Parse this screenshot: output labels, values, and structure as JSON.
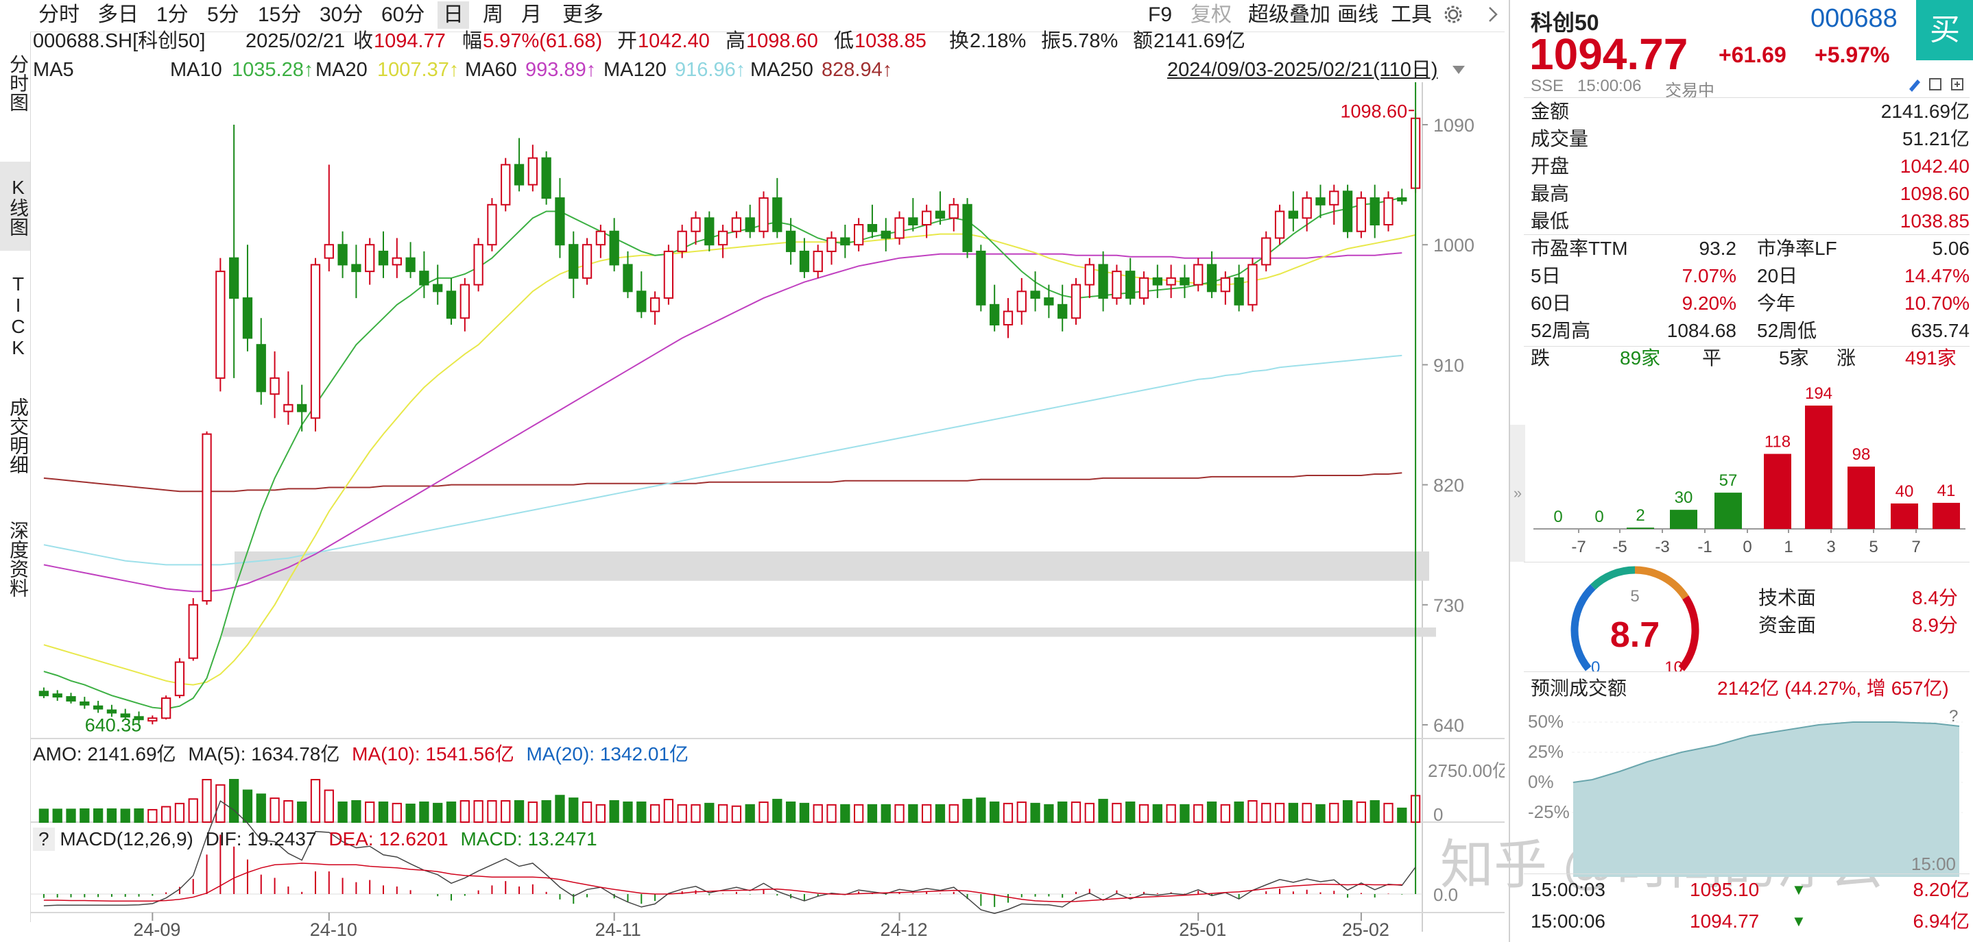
{
  "toolbar": {
    "periods": [
      "分时",
      "多日",
      "1分",
      "5分",
      "15分",
      "30分",
      "60分",
      "日",
      "周",
      "月",
      "更多"
    ],
    "active_period": "日",
    "right": [
      "F9",
      "复权",
      "超级叠加",
      "画线",
      "工具"
    ]
  },
  "side_tabs": [
    "分时图",
    "K线图",
    "TICK",
    "成交明细",
    "深度资料"
  ],
  "active_side_tab": "K线图",
  "info": {
    "code": "000688.SH[科创50]",
    "date": "2025/02/21",
    "close_label": "收",
    "close": "1094.77",
    "chg_label": "幅",
    "chg": "5.97%(61.68)",
    "open_label": "开",
    "open": "1042.40",
    "high_label": "高",
    "high": "1098.60",
    "low_label": "低",
    "low": "1038.85",
    "turnover_label": "换",
    "turnover": "2.18%",
    "amplitude_label": "振",
    "amplitude": "5.78%",
    "amount_label": "额",
    "amount": "2141.69亿"
  },
  "ma": {
    "ma5": "MA5",
    "ma10_label": "MA10",
    "ma10": "1035.28↑",
    "ma20_label": "MA20",
    "ma20": "1007.37↑",
    "ma60_label": "MA60",
    "ma60": "993.89↑",
    "ma120_label": "MA120",
    "ma120": "916.96↑",
    "ma250_label": "MA250",
    "ma250": "828.94↑",
    "range": "2024/09/03-2025/02/21(110日)"
  },
  "colors": {
    "up": "#d0021b",
    "down": "#1a8a1a",
    "ma10": "#3cb043",
    "ma20": "#e8e84a",
    "ma60": "#c040c0",
    "ma120": "#9ee0ea",
    "ma250": "#a03030"
  },
  "chart_data": {
    "type": "candlestick",
    "y_ticks": [
      "1090",
      "1000",
      "910",
      "820",
      "730",
      "640"
    ],
    "ylim": [
      640,
      1090
    ],
    "x_ticks": [
      "24-09",
      "24-10",
      "24-11",
      "24-12",
      "25-01",
      "25-02"
    ],
    "high_label": "1098.60",
    "low_label": "640.35",
    "candles_ohlc": [
      [
        665,
        668,
        660,
        662
      ],
      [
        663,
        666,
        658,
        661
      ],
      [
        661,
        664,
        656,
        658
      ],
      [
        657,
        661,
        652,
        655
      ],
      [
        654,
        658,
        649,
        652
      ],
      [
        651,
        655,
        646,
        649
      ],
      [
        648,
        652,
        644,
        646
      ],
      [
        646,
        650,
        641,
        644
      ],
      [
        643,
        647,
        640.35,
        645
      ],
      [
        645,
        662,
        644,
        660
      ],
      [
        662,
        690,
        660,
        687
      ],
      [
        690,
        735,
        688,
        730
      ],
      [
        733,
        860,
        730,
        858
      ],
      [
        900,
        990,
        890,
        980
      ],
      [
        990,
        1090,
        900,
        960
      ],
      [
        960,
        1000,
        920,
        930
      ],
      [
        925,
        945,
        880,
        890
      ],
      [
        888,
        920,
        870,
        900
      ],
      [
        875,
        905,
        865,
        880
      ],
      [
        880,
        895,
        860,
        875
      ],
      [
        870,
        990,
        860,
        985
      ],
      [
        990,
        1060,
        980,
        1000
      ],
      [
        1000,
        1010,
        975,
        985
      ],
      [
        985,
        1000,
        960,
        980
      ],
      [
        980,
        1005,
        970,
        1000
      ],
      [
        995,
        1010,
        975,
        985
      ],
      [
        985,
        1005,
        975,
        990
      ],
      [
        990,
        1002,
        975,
        980
      ],
      [
        980,
        995,
        960,
        970
      ],
      [
        970,
        985,
        955,
        965
      ],
      [
        965,
        975,
        940,
        945
      ],
      [
        945,
        975,
        935,
        970
      ],
      [
        970,
        1005,
        965,
        1000
      ],
      [
        1000,
        1035,
        995,
        1030
      ],
      [
        1030,
        1065,
        1025,
        1060
      ],
      [
        1060,
        1080,
        1040,
        1045
      ],
      [
        1045,
        1075,
        1040,
        1065
      ],
      [
        1065,
        1070,
        1030,
        1035
      ],
      [
        1035,
        1050,
        990,
        1000
      ],
      [
        1000,
        1010,
        960,
        975
      ],
      [
        975,
        1005,
        970,
        1000
      ],
      [
        1000,
        1015,
        990,
        1010
      ],
      [
        1010,
        1020,
        980,
        985
      ],
      [
        985,
        995,
        960,
        965
      ],
      [
        965,
        980,
        945,
        950
      ],
      [
        950,
        965,
        940,
        960
      ],
      [
        960,
        1000,
        955,
        995
      ],
      [
        995,
        1015,
        990,
        1010
      ],
      [
        1010,
        1025,
        1000,
        1020
      ],
      [
        1020,
        1025,
        995,
        1000
      ],
      [
        1000,
        1015,
        990,
        1010
      ],
      [
        1010,
        1025,
        1005,
        1020
      ],
      [
        1020,
        1030,
        1005,
        1010
      ],
      [
        1010,
        1040,
        1005,
        1035
      ],
      [
        1035,
        1050,
        1005,
        1010
      ],
      [
        1010,
        1020,
        985,
        995
      ],
      [
        995,
        1005,
        975,
        980
      ],
      [
        980,
        1000,
        975,
        995
      ],
      [
        995,
        1010,
        985,
        1005
      ],
      [
        1005,
        1015,
        990,
        1000
      ],
      [
        1000,
        1020,
        995,
        1015
      ],
      [
        1015,
        1030,
        1005,
        1010
      ],
      [
        1010,
        1020,
        995,
        1005
      ],
      [
        1005,
        1025,
        1000,
        1020
      ],
      [
        1020,
        1035,
        1010,
        1015
      ],
      [
        1015,
        1030,
        1005,
        1025
      ],
      [
        1025,
        1040,
        1015,
        1020
      ],
      [
        1020,
        1035,
        1010,
        1030
      ],
      [
        1030,
        1035,
        990,
        995
      ],
      [
        995,
        1000,
        950,
        955
      ],
      [
        955,
        970,
        935,
        940
      ],
      [
        940,
        960,
        930,
        950
      ],
      [
        950,
        975,
        940,
        965
      ],
      [
        965,
        980,
        950,
        960
      ],
      [
        960,
        970,
        945,
        955
      ],
      [
        955,
        970,
        935,
        945
      ],
      [
        945,
        975,
        940,
        970
      ],
      [
        970,
        990,
        960,
        985
      ],
      [
        985,
        995,
        950,
        960
      ],
      [
        960,
        985,
        955,
        980
      ],
      [
        980,
        990,
        955,
        960
      ],
      [
        960,
        980,
        955,
        975
      ],
      [
        975,
        985,
        960,
        970
      ],
      [
        970,
        985,
        960,
        975
      ],
      [
        975,
        985,
        960,
        970
      ],
      [
        970,
        990,
        965,
        985
      ],
      [
        985,
        995,
        960,
        965
      ],
      [
        965,
        980,
        955,
        975
      ],
      [
        975,
        985,
        950,
        955
      ],
      [
        955,
        990,
        950,
        985
      ],
      [
        985,
        1010,
        980,
        1005
      ],
      [
        1005,
        1030,
        1000,
        1025
      ],
      [
        1025,
        1040,
        1010,
        1020
      ],
      [
        1020,
        1040,
        1010,
        1035
      ],
      [
        1035,
        1045,
        1020,
        1030
      ],
      [
        1030,
        1045,
        1015,
        1040
      ],
      [
        1040,
        1045,
        1005,
        1010
      ],
      [
        1010,
        1040,
        1005,
        1035
      ],
      [
        1035,
        1045,
        1005,
        1015
      ],
      [
        1015,
        1040,
        1010,
        1035
      ],
      [
        1035,
        1042,
        1030,
        1033
      ],
      [
        1042.4,
        1098.6,
        1038.85,
        1094.77
      ]
    ],
    "ma10": [
      680,
      677,
      673,
      670,
      666,
      662,
      659,
      656,
      653,
      652,
      654,
      660,
      675,
      705,
      740,
      770,
      800,
      825,
      845,
      865,
      880,
      895,
      910,
      925,
      935,
      945,
      955,
      962,
      970,
      975,
      975,
      978,
      983,
      990,
      1000,
      1010,
      1020,
      1025,
      1025,
      1020,
      1015,
      1010,
      1005,
      1000,
      995,
      992,
      993,
      997,
      1002,
      1005,
      1008,
      1010,
      1012,
      1015,
      1017,
      1015,
      1010,
      1005,
      1002,
      1001,
      1003,
      1006,
      1008,
      1010,
      1012,
      1015,
      1018,
      1020,
      1018,
      1010,
      1000,
      990,
      980,
      972,
      966,
      962,
      960,
      961,
      962,
      963,
      964,
      965,
      966,
      967,
      968,
      970,
      972,
      975,
      978,
      985,
      992,
      1000,
      1008,
      1015,
      1022,
      1025,
      1027,
      1030,
      1031,
      1033,
      1035.28
    ],
    "ma20": [
      700,
      697,
      694,
      691,
      688,
      685,
      682,
      679,
      676,
      673,
      671,
      670,
      672,
      678,
      688,
      700,
      715,
      730,
      748,
      765,
      782,
      800,
      815,
      830,
      845,
      858,
      870,
      882,
      893,
      902,
      910,
      918,
      925,
      935,
      945,
      955,
      965,
      972,
      978,
      982,
      985,
      988,
      990,
      991,
      992,
      992,
      993,
      994,
      995,
      996,
      997,
      998,
      999,
      1000,
      1001,
      1002,
      1002,
      1002,
      1002,
      1002,
      1002,
      1003,
      1004,
      1005,
      1006,
      1007,
      1008,
      1008,
      1008,
      1006,
      1003,
      1000,
      997,
      994,
      990,
      987,
      984,
      982,
      980,
      978,
      976,
      975,
      974,
      973,
      972,
      971,
      970,
      970,
      971,
      973,
      975,
      978,
      982,
      986,
      990,
      994,
      997,
      999,
      1001,
      1003,
      1005,
      1007.37
    ],
    "ma60": [
      760,
      758,
      756,
      754,
      752,
      750,
      748,
      746,
      744,
      742,
      741,
      740,
      740,
      741,
      743,
      746,
      750,
      754,
      758,
      763,
      768,
      774,
      780,
      786,
      792,
      798,
      804,
      810,
      816,
      822,
      828,
      834,
      840,
      846,
      852,
      858,
      864,
      870,
      876,
      882,
      888,
      894,
      900,
      906,
      912,
      918,
      924,
      930,
      935,
      940,
      945,
      950,
      955,
      960,
      964,
      968,
      972,
      975,
      978,
      981,
      984,
      986,
      988,
      990,
      991,
      992,
      993,
      993,
      993,
      993,
      993,
      993,
      993,
      993,
      993,
      993,
      992,
      992,
      992,
      992,
      991,
      991,
      991,
      991,
      990,
      990,
      990,
      990,
      990,
      990,
      990,
      990,
      990,
      990,
      991,
      991,
      992,
      992,
      992,
      993,
      993.89
    ],
    "ma120": [
      775,
      773,
      771,
      769,
      767,
      765,
      763,
      762,
      761,
      760,
      760,
      760,
      760,
      760,
      761,
      762,
      763,
      764,
      765,
      767,
      769,
      771,
      773,
      775,
      777,
      779,
      781,
      783,
      785,
      787,
      789,
      791,
      793,
      795,
      797,
      799,
      801,
      803,
      805,
      807,
      809,
      811,
      813,
      815,
      817,
      819,
      821,
      823,
      825,
      827,
      829,
      831,
      833,
      835,
      837,
      839,
      841,
      843,
      845,
      847,
      849,
      851,
      853,
      855,
      857,
      859,
      861,
      863,
      865,
      867,
      869,
      871,
      873,
      875,
      877,
      879,
      881,
      883,
      885,
      887,
      889,
      891,
      893,
      895,
      897,
      899,
      900,
      902,
      903,
      905,
      906,
      908,
      909,
      910,
      911,
      912,
      913,
      914,
      915,
      916,
      916.96
    ],
    "ma250": [
      825,
      824,
      823,
      822,
      821,
      820,
      819,
      818,
      817,
      816,
      815,
      815,
      815,
      815,
      815,
      816,
      816,
      816,
      817,
      817,
      817,
      818,
      818,
      818,
      818,
      819,
      819,
      819,
      819,
      819,
      820,
      820,
      820,
      820,
      820,
      820,
      820,
      820,
      820,
      820,
      821,
      821,
      821,
      821,
      821,
      821,
      821,
      821,
      821,
      822,
      822,
      822,
      822,
      822,
      822,
      822,
      822,
      822,
      822,
      823,
      823,
      823,
      823,
      823,
      823,
      823,
      823,
      823,
      823,
      824,
      824,
      824,
      824,
      824,
      824,
      824,
      824,
      824,
      825,
      825,
      825,
      825,
      825,
      825,
      825,
      825,
      826,
      826,
      826,
      826,
      826,
      826,
      826,
      827,
      827,
      827,
      827,
      827,
      828,
      828,
      828.94
    ],
    "gray_bands": [
      [
        748,
        770
      ],
      [
        706,
        713
      ]
    ]
  },
  "amo": {
    "amo_label": "AMO: 2141.69亿",
    "ma5": "MA(5): 1634.78亿",
    "ma10": "MA(10): 1541.56亿",
    "ma20": "MA(20): 1342.01亿",
    "y_top": "2750.00亿",
    "y_zero": "0"
  },
  "macd": {
    "help": "?",
    "label": "MACD(12,26,9)",
    "dif": "DIF: 19.2437",
    "dea": "DEA: 12.6201",
    "macd": "MACD: 13.2471",
    "y_zero": "0.0"
  },
  "quote": {
    "name": "科创50",
    "code": "000688",
    "price": "1094.77",
    "change": "+61.69",
    "change_pct": "+5.97%",
    "buy": "买",
    "exchange": "SSE",
    "time": "15:00:06",
    "status": "交易中"
  },
  "stats": [
    [
      "金额",
      "2141.69亿"
    ],
    [
      "成交量",
      "51.21亿"
    ],
    [
      "开盘",
      "1042.40"
    ],
    [
      "最高",
      "1098.60"
    ],
    [
      "最低",
      "1038.85"
    ]
  ],
  "stats2": [
    [
      "市盈率TTM",
      "93.2",
      "市净率LF",
      "5.06"
    ],
    [
      "5日",
      "7.07%",
      "20日",
      "14.47%"
    ],
    [
      "60日",
      "9.20%",
      "今年",
      "10.70%"
    ],
    [
      "52周高",
      "1084.68",
      "52周低",
      "635.74"
    ]
  ],
  "breadth": {
    "down_label": "跌",
    "down": "89家",
    "flat_label": "平",
    "flat": "5家",
    "up_label": "涨",
    "up": "491家"
  },
  "dist_chart": {
    "x_ticks": [
      "-7",
      "-5",
      "-3",
      "-1",
      "0",
      "1",
      "3",
      "5",
      "7"
    ],
    "values": [
      0,
      0,
      2,
      30,
      57,
      118,
      194,
      98,
      40,
      41
    ]
  },
  "gauge": {
    "value": "8.7",
    "min": "0",
    "mid": "5",
    "max": "10",
    "tech_label": "技术面",
    "tech": "8.4分",
    "fund_label": "资金面",
    "fund": "8.9分"
  },
  "forecast": {
    "label": "预测成交额",
    "value": "2142亿 (44.27%, 增 657亿)",
    "ticks": [
      "50%",
      "25%",
      "0%",
      "-25%"
    ],
    "time_end": "15:00",
    "help": "?"
  },
  "ticks_list": [
    [
      "15:00:03",
      "1095.10",
      "8.20亿"
    ],
    [
      "15:00:06",
      "1094.77",
      "6.94亿"
    ]
  ],
  "watermark": "知乎 @时间的浮云"
}
